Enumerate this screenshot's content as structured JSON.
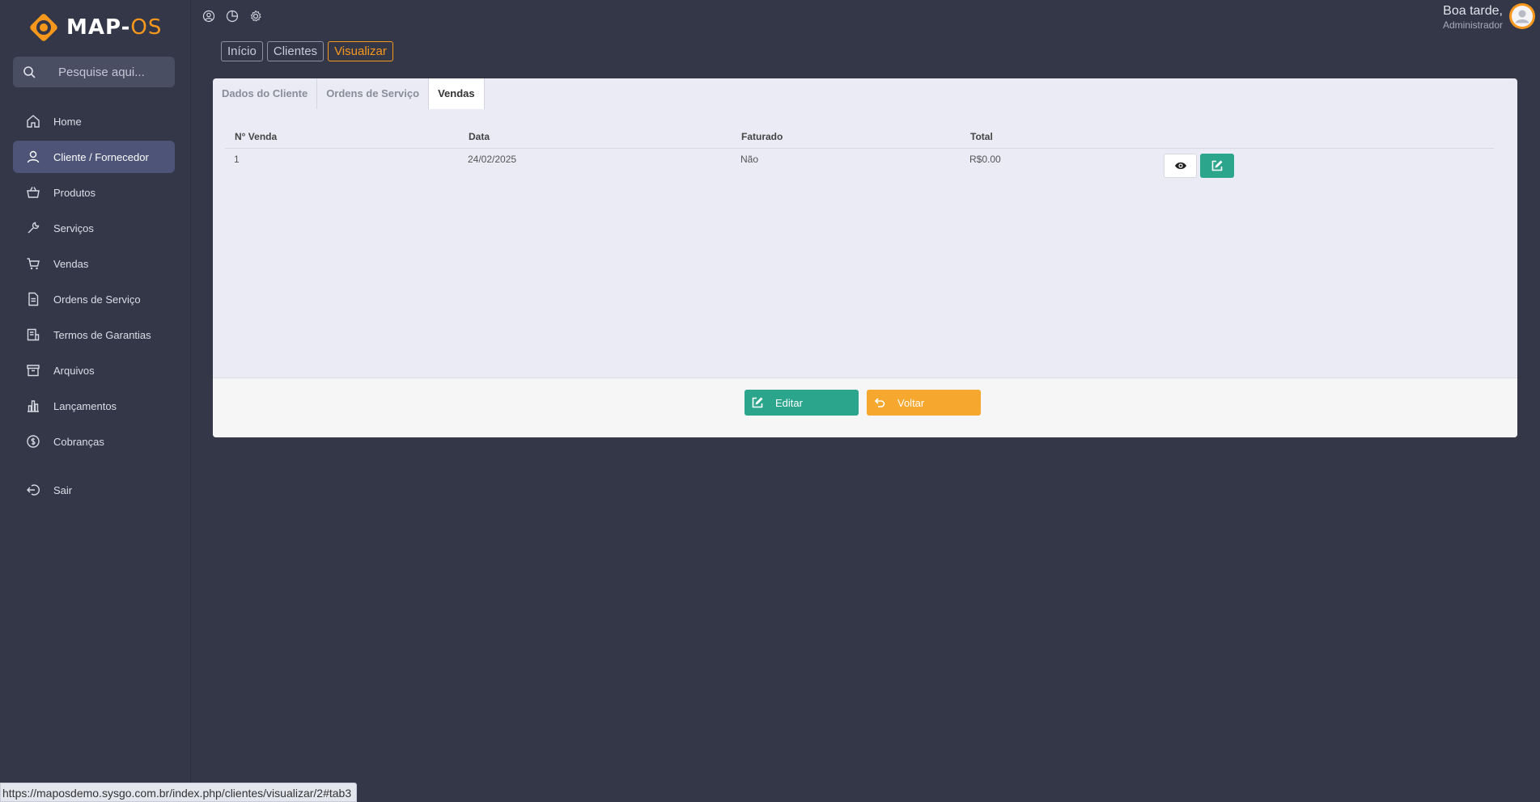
{
  "brand": {
    "name_main": "MAP-",
    "name_accent": "OS"
  },
  "search": {
    "placeholder": "Pesquise aqui..."
  },
  "sidebar": {
    "items": [
      {
        "label": "Home",
        "icon": "home-icon"
      },
      {
        "label": "Cliente / Fornecedor",
        "icon": "user-icon",
        "active": true
      },
      {
        "label": "Produtos",
        "icon": "basket-icon"
      },
      {
        "label": "Serviços",
        "icon": "wrench-icon"
      },
      {
        "label": "Vendas",
        "icon": "cart-icon"
      },
      {
        "label": "Ordens de Serviço",
        "icon": "document-icon"
      },
      {
        "label": "Termos de Garantias",
        "icon": "receipt-icon"
      },
      {
        "label": "Arquivos",
        "icon": "archive-icon"
      },
      {
        "label": "Lançamentos",
        "icon": "bar-chart-icon"
      },
      {
        "label": "Cobranças",
        "icon": "dollar-icon"
      }
    ],
    "logout": {
      "label": "Sair",
      "icon": "logout-icon"
    }
  },
  "header": {
    "greeting": "Boa tarde,",
    "role": "Administrador"
  },
  "breadcrumb": [
    "Início",
    "Clientes",
    "Visualizar"
  ],
  "tabs": [
    {
      "label": "Dados do Cliente"
    },
    {
      "label": "Ordens de Serviço"
    },
    {
      "label": "Vendas",
      "active": true
    }
  ],
  "table": {
    "columns": [
      "N° Venda",
      "Data",
      "Faturado",
      "Total"
    ],
    "rows": [
      {
        "numero": "1",
        "data": "24/02/2025",
        "faturado": "Não",
        "total": "R$0.00"
      }
    ]
  },
  "actions": {
    "edit_label": "Editar",
    "back_label": "Voltar"
  },
  "status_url": "https://maposdemo.sysgo.com.br/index.php/clientes/visualizar/2#tab3",
  "colors": {
    "accent": "#f7981c",
    "success": "#2ca58d",
    "warning": "#f6a72e",
    "sidebar_bg": "#343748",
    "active_item": "#4d5478"
  }
}
